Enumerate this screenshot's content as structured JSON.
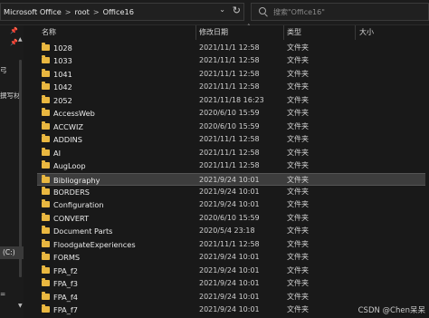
{
  "address": {
    "crumbs": [
      "Microsoft Office",
      "root",
      "Office16"
    ],
    "separator": ">",
    "dropdown_icon": "chevron-down-icon",
    "refresh_icon": "refresh-icon"
  },
  "search": {
    "placeholder": "搜索\"Office16\""
  },
  "nav": {
    "texts": [
      "弓",
      "撰写材",
      "(C:)",
      "="
    ]
  },
  "columns": {
    "name": "名称",
    "date": "修改日期",
    "type": "类型",
    "size": "大小"
  },
  "files": [
    {
      "name": "1028",
      "date": "2021/11/1 12:58",
      "type": "文件夹"
    },
    {
      "name": "1033",
      "date": "2021/11/1 12:58",
      "type": "文件夹"
    },
    {
      "name": "1041",
      "date": "2021/11/1 12:58",
      "type": "文件夹"
    },
    {
      "name": "1042",
      "date": "2021/11/1 12:58",
      "type": "文件夹"
    },
    {
      "name": "2052",
      "date": "2021/11/18 16:23",
      "type": "文件夹"
    },
    {
      "name": "AccessWeb",
      "date": "2020/6/10 15:59",
      "type": "文件夹"
    },
    {
      "name": "ACCWIZ",
      "date": "2020/6/10 15:59",
      "type": "文件夹"
    },
    {
      "name": "ADDINS",
      "date": "2021/11/1 12:58",
      "type": "文件夹"
    },
    {
      "name": "AI",
      "date": "2021/11/1 12:58",
      "type": "文件夹"
    },
    {
      "name": "AugLoop",
      "date": "2021/11/1 12:58",
      "type": "文件夹"
    },
    {
      "name": "Bibliography",
      "date": "2021/9/24 10:01",
      "type": "文件夹",
      "selected": true
    },
    {
      "name": "BORDERS",
      "date": "2021/9/24 10:01",
      "type": "文件夹"
    },
    {
      "name": "Configuration",
      "date": "2021/9/24 10:01",
      "type": "文件夹"
    },
    {
      "name": "CONVERT",
      "date": "2020/6/10 15:59",
      "type": "文件夹"
    },
    {
      "name": "Document Parts",
      "date": "2020/5/4 23:18",
      "type": "文件夹"
    },
    {
      "name": "FloodgateExperiences",
      "date": "2021/11/1 12:58",
      "type": "文件夹"
    },
    {
      "name": "FORMS",
      "date": "2021/9/24 10:01",
      "type": "文件夹"
    },
    {
      "name": "FPA_f2",
      "date": "2021/9/24 10:01",
      "type": "文件夹"
    },
    {
      "name": "FPA_f3",
      "date": "2021/9/24 10:01",
      "type": "文件夹"
    },
    {
      "name": "FPA_f4",
      "date": "2021/9/24 10:01",
      "type": "文件夹"
    },
    {
      "name": "FPA_f7",
      "date": "2021/9/24 10:01",
      "type": "文件夹"
    }
  ],
  "watermark": "CSDN @Chen呆呆",
  "colors": {
    "folder": "#e9b740",
    "background": "#191919",
    "selection": "#3d3d3d"
  }
}
